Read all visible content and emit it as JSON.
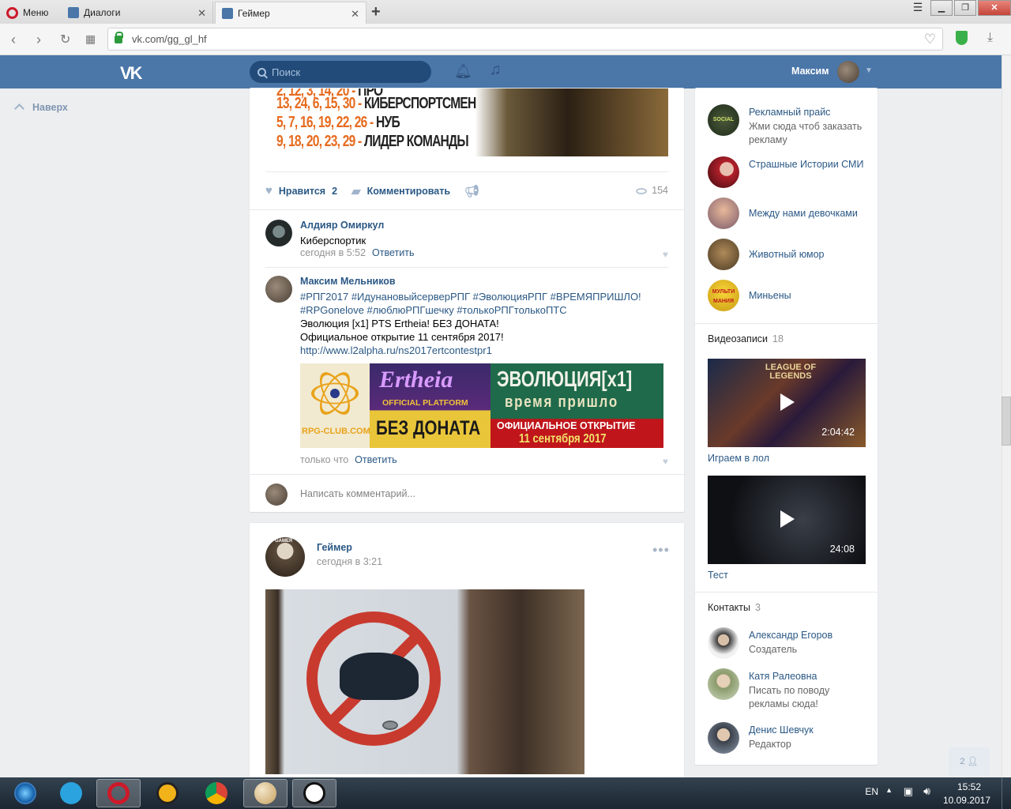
{
  "browser": {
    "tabs": [
      {
        "label": "Меню"
      },
      {
        "label": "Диалоги"
      },
      {
        "label": "Геймер"
      }
    ],
    "url": "vk.com/gg_gl_hf",
    "colors": {
      "opera_red": "#cc1a2a",
      "vk_blue": "#4a76a8",
      "secure_green": "#2d9b3c"
    }
  },
  "vk_header": {
    "search_placeholder": "Поиск",
    "user_name": "Максим",
    "icons": [
      "vk-logo-icon",
      "bell-icon",
      "music-icon",
      "chevron-down-icon"
    ]
  },
  "side": {
    "up_label": "Наверх"
  },
  "post1": {
    "banner_lines": [
      {
        "nums": "2, 12, 3, 14, 20 -",
        "word": "ПРО"
      },
      {
        "nums": "13, 24, 6, 15, 30 -",
        "word": "КИБЕРСПОРТСМЕН"
      },
      {
        "nums": "5, 7, 16, 19, 22, 26 -",
        "word": "НУБ"
      },
      {
        "nums": "9, 18, 20, 23, 29 -",
        "word": "ЛИДЕР КОМАНДЫ"
      }
    ],
    "like_label": "Нравится",
    "like_count": "2",
    "comment_label": "Комментировать",
    "views": "154",
    "comments": [
      {
        "author": "Алдияр Омиркул",
        "text": "Киберспортик",
        "time": "сегодня в 5:52",
        "reply": "Ответить"
      },
      {
        "author": "Максим Мельников",
        "hashtags_1": "#РПГ2017 #ИдунановыйсерверРПГ #ЭволюцияРПГ #ВРЕМЯПРИШЛО!",
        "hashtags_2": "#RPGonelove #люблюРПГшечку #толькоРПГтолькоПТС",
        "line_1": "Эволюция [x1] PTS Ertheia! БЕЗ ДОНАТА!",
        "line_2": "Официальное открытие 11 сентября 2017!",
        "link": "http://www.l2alpha.ru/ns2017ertcontestpr1",
        "banner": {
          "logo": "RPG-CLUB.COM",
          "brand": "Ertheia",
          "platform": "OFFICIAL PLATFORM",
          "nodonat": "БЕЗ ДОНАТА",
          "evo": "ЭВОЛЮЦИЯ[x1]",
          "time": "время пришло",
          "open1": "ОФИЦИАЛЬНОЕ ОТКРЫТИЕ",
          "open2": "11 сентября 2017"
        },
        "time": "только что",
        "reply": "Ответить"
      }
    ],
    "write_placeholder": "Написать комментарий..."
  },
  "post2": {
    "author": "Геймер",
    "time": "сегодня в 3:21",
    "avatar_label": "GAMER"
  },
  "right": {
    "groups": [
      {
        "name": "Рекламный прайс",
        "sub": "Жми сюда чтоб заказать рекламу",
        "avatar_text": "SOCIAL MEDIA"
      },
      {
        "name": "Страшные Истории СМИ",
        "sub": ""
      },
      {
        "name": "Между нами девочками",
        "sub": ""
      },
      {
        "name": "Животный юмор",
        "sub": ""
      },
      {
        "name": "Миньены",
        "sub": "",
        "avatar_text": "МУЛЬТИ МАНИЯ"
      }
    ],
    "videos_title": "Видеозаписи",
    "videos_count": "18",
    "videos": [
      {
        "title": "Играем в лол",
        "duration": "2:04:42",
        "overlay": "LEAGUE OF LEGENDS"
      },
      {
        "title": "Тест",
        "duration": "24:08"
      }
    ],
    "contacts_title": "Контакты",
    "contacts_count": "3",
    "contacts": [
      {
        "name": "Александр Егоров",
        "role": "Создатель"
      },
      {
        "name": "Катя Ралеовна",
        "role": "Писать по поводу рекламы сюда!"
      },
      {
        "name": "Денис Шевчук",
        "role": "Редактор"
      }
    ],
    "chat_count": "2"
  },
  "taskbar": {
    "lang": "EN",
    "time": "15:52",
    "date": "10.09.2017"
  }
}
